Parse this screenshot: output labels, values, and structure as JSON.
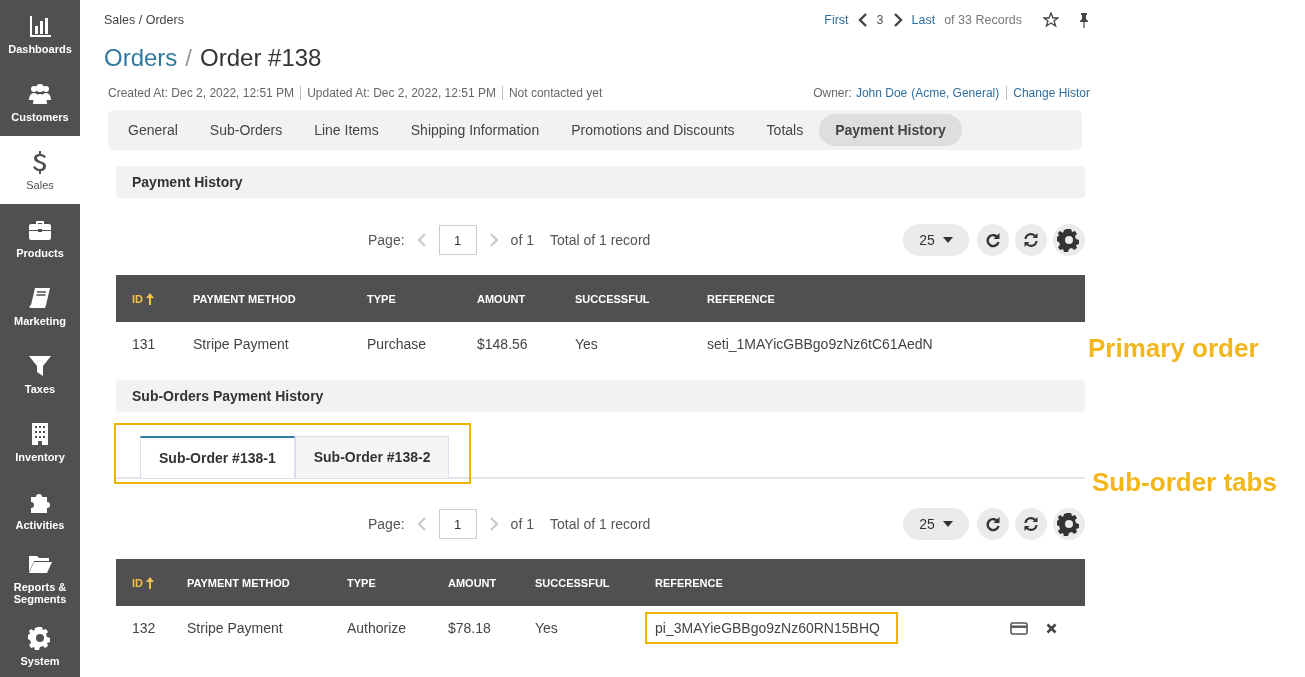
{
  "sidebar": {
    "items": [
      {
        "label": "Dashboards",
        "selected": false
      },
      {
        "label": "Customers",
        "selected": false
      },
      {
        "label": "Sales",
        "selected": true
      },
      {
        "label": "Products",
        "selected": false
      },
      {
        "label": "Marketing",
        "selected": false
      },
      {
        "label": "Taxes",
        "selected": false
      },
      {
        "label": "Inventory",
        "selected": false
      },
      {
        "label": "Activities",
        "selected": false
      },
      {
        "label": "Reports & Segments",
        "selected": false
      },
      {
        "label": "System",
        "selected": false
      }
    ]
  },
  "breadcrumb": "Sales / Orders",
  "record_nav": {
    "first": "First",
    "current": "3",
    "last": "Last",
    "total": "of 33 Records"
  },
  "title": {
    "parent": "Orders",
    "separator": "/",
    "current": "Order #138"
  },
  "meta": [
    "Created At: Dec 2, 2022, 12:51 PM",
    "Updated At: Dec 2, 2022, 12:51 PM",
    "Not contacted yet"
  ],
  "owner": {
    "label": "Owner:",
    "name": "John Doe",
    "org": "(Acme, General)",
    "change_history": "Change Histor"
  },
  "tabs": [
    {
      "label": "General",
      "selected": false
    },
    {
      "label": "Sub-Orders",
      "selected": false
    },
    {
      "label": "Line Items",
      "selected": false
    },
    {
      "label": "Shipping Information",
      "selected": false
    },
    {
      "label": "Promotions and Discounts",
      "selected": false
    },
    {
      "label": "Totals",
      "selected": false
    },
    {
      "label": "Payment History",
      "selected": true
    }
  ],
  "payment_history": {
    "title": "Payment History",
    "grid": {
      "pager": {
        "page_label": "Page:",
        "page": "1",
        "of": "of 1",
        "total": "Total of 1 record",
        "page_size": "25"
      },
      "columns": [
        "ID",
        "PAYMENT METHOD",
        "TYPE",
        "AMOUNT",
        "SUCCESSFUL",
        "REFERENCE"
      ],
      "rows": [
        {
          "cells": [
            "131",
            "Stripe Payment",
            "Purchase",
            "$148.56",
            "Yes",
            "seti_1MAYicGBBgo9zNz6tC61AedN"
          ],
          "reference_highlighted": false,
          "actions": false
        }
      ]
    }
  },
  "sub_orders": {
    "title": "Sub-Orders Payment History",
    "tabs_highlighted": true,
    "tabs": [
      {
        "label": "Sub-Order #138-1",
        "selected": true
      },
      {
        "label": "Sub-Order #138-2",
        "selected": false
      }
    ],
    "grid": {
      "pager": {
        "page_label": "Page:",
        "page": "1",
        "of": "of 1",
        "total": "Total of 1 record",
        "page_size": "25"
      },
      "columns": [
        "ID",
        "PAYMENT METHOD",
        "TYPE",
        "AMOUNT",
        "SUCCESSFUL",
        "REFERENCE"
      ],
      "rows": [
        {
          "cells": [
            "132",
            "Stripe Payment",
            "Authorize",
            "$78.18",
            "Yes",
            "pi_3MAYieGBBgo9zNz60RN15BHQ"
          ],
          "reference_highlighted": true,
          "actions": true
        }
      ]
    }
  },
  "annotations": [
    "Primary order",
    "Sub-order tabs"
  ]
}
